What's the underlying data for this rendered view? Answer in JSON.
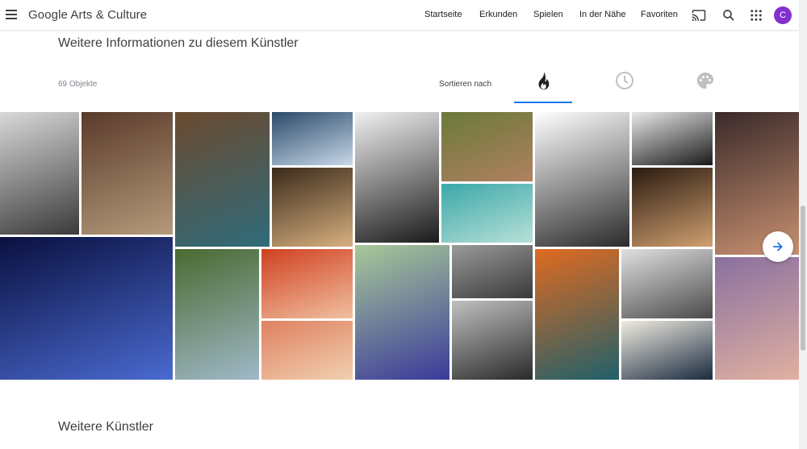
{
  "header": {
    "brand": "Google Arts & Culture",
    "nav": [
      "Startseite",
      "Erkunden",
      "Spielen",
      "In der Nähe",
      "Favoriten"
    ],
    "avatar_letter": "C",
    "avatar_color": "#8430ce",
    "icons": [
      "menu-icon",
      "cast-icon",
      "search-icon",
      "apps-grid-icon"
    ]
  },
  "section": {
    "title": "Weitere Informationen zu diesem Künstler",
    "count": "69 Objekte",
    "sort_label": "Sortieren nach",
    "sort_tabs": [
      {
        "name": "popular-fire-icon",
        "active": true
      },
      {
        "name": "time-clock-icon",
        "active": false
      },
      {
        "name": "color-palette-icon",
        "active": false
      }
    ],
    "accent_color": "#1a73e8"
  },
  "gallery": {
    "tiles": [
      {
        "name": "photo-bw-seated-woman",
        "colors": [
          "#d9d9d9",
          "#3a3a3a"
        ]
      },
      {
        "name": "photo-woman-in-gown-with-dog",
        "colors": [
          "#5a3a2a",
          "#b59a7a"
        ]
      },
      {
        "name": "photo-woman-blue-caftan",
        "colors": [
          "#6b4a30",
          "#2f6b7a"
        ]
      },
      {
        "name": "photo-boy-blue-shirt",
        "colors": [
          "#2a4a6a",
          "#c8d8e8"
        ]
      },
      {
        "name": "photo-bacchus-portrait",
        "colors": [
          "#3a2a1a",
          "#d8b080"
        ]
      },
      {
        "name": "photo-bw-knit-hat",
        "colors": [
          "#f0f0f0",
          "#1a1a1a"
        ]
      },
      {
        "name": "photo-woman-in-landscape",
        "colors": [
          "#6a7a3a",
          "#b08060"
        ]
      },
      {
        "name": "photo-teal-debris",
        "colors": [
          "#3aa8a8",
          "#b8e0d8"
        ]
      },
      {
        "name": "photo-bw-veiled-face",
        "colors": [
          "#ffffff",
          "#2a2a2a"
        ]
      },
      {
        "name": "photo-bw-curly-hair",
        "colors": [
          "#e8e8e8",
          "#1a1a1a"
        ]
      },
      {
        "name": "photo-bacchus-small",
        "colors": [
          "#2a1a10",
          "#d0a070"
        ]
      },
      {
        "name": "photo-distorted-faces",
        "colors": [
          "#3a2a2a",
          "#c89070"
        ]
      },
      {
        "name": "photo-blue-reclining-figure",
        "colors": [
          "#0a1040",
          "#4a6ad0"
        ]
      },
      {
        "name": "photo-woman-in-moss",
        "colors": [
          "#4a6a30",
          "#a0b8c8"
        ]
      },
      {
        "name": "photo-clowns",
        "colors": [
          "#d04020",
          "#f0c0a0"
        ]
      },
      {
        "name": "photo-woman-on-floor",
        "colors": [
          "#e08060",
          "#f0d0b0"
        ]
      },
      {
        "name": "photo-woman-purple-dress",
        "colors": [
          "#a8c898",
          "#3a3a9a"
        ]
      },
      {
        "name": "photo-bw-road-scene",
        "colors": [
          "#9a9a9a",
          "#3a3a3a"
        ]
      },
      {
        "name": "photo-bw-doorway",
        "colors": [
          "#c0c0c0",
          "#2a2a2a"
        ]
      },
      {
        "name": "photo-clown-pink-hair",
        "colors": [
          "#e06a20",
          "#20606a"
        ]
      },
      {
        "name": "photo-bw-kitchen",
        "colors": [
          "#e0e0e0",
          "#4a4a4a"
        ]
      },
      {
        "name": "photo-woman-dark-blazer",
        "colors": [
          "#f0ece0",
          "#1a2a40"
        ]
      },
      {
        "name": "photo-pastel-distorted-face",
        "colors": [
          "#8a70a0",
          "#e0b0a0"
        ]
      }
    ]
  },
  "more_artists_title": "Weitere Künstler"
}
